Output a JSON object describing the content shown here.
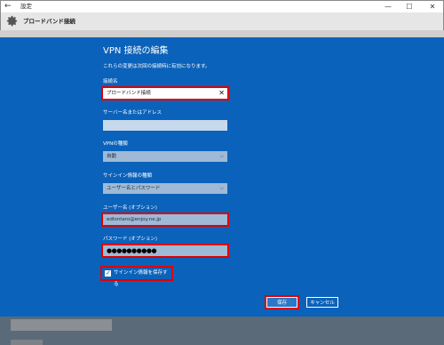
{
  "window": {
    "title": "設定",
    "back_icon": "back-arrow-icon",
    "controls": {
      "minimize": "—",
      "maximize": "☐",
      "close": "✕"
    }
  },
  "header": {
    "title": "ブロードバンド接続",
    "icon": "gear-icon"
  },
  "dialog": {
    "title": "VPN 接続の編集",
    "subtitle": "これらの変更は次回の接続時に有効になります。",
    "connection_name": {
      "label": "接続名",
      "value": "ブロードバンド接続"
    },
    "server": {
      "label": "サーバー名またはアドレス",
      "value": ""
    },
    "vpn_type": {
      "label": "VPNの種類",
      "value": "自動"
    },
    "signin_type": {
      "label": "サインイン情報の種類",
      "value": "ユーザー名とパスワード"
    },
    "username": {
      "label": "ユーザー名 (オプション)",
      "value": "edlontaro@enjoy.ne.jp"
    },
    "password": {
      "label": "パスワード (オプション)",
      "value": "●●●●●●●●●●"
    },
    "remember": {
      "label": "サインイン情報を保存する",
      "checked": true
    },
    "save_label": "保存",
    "cancel_label": "キャンセル"
  },
  "colors": {
    "dialog_bg": "#0b62ba",
    "highlight": "#e00000"
  }
}
